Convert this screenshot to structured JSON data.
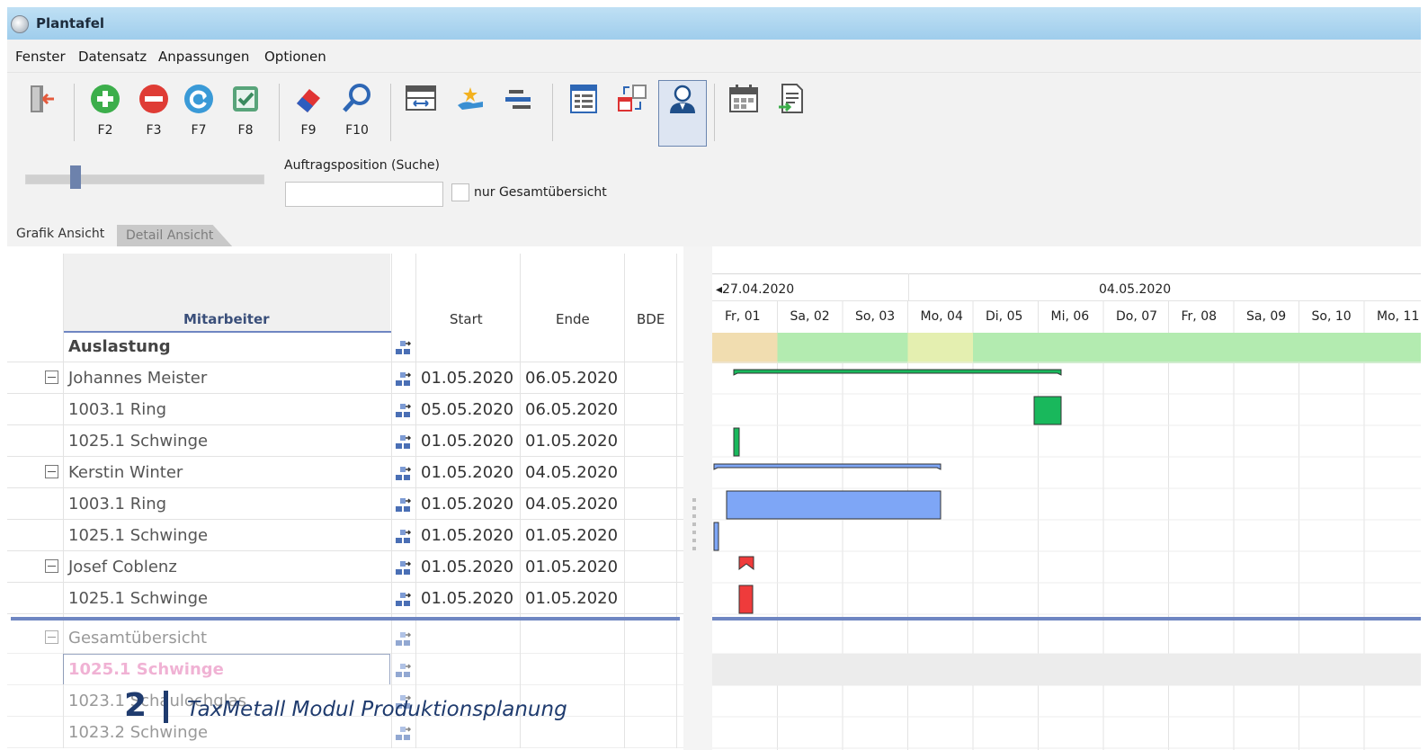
{
  "window": {
    "title": "Plantafel"
  },
  "menu": [
    "Fenster",
    "Datensatz",
    "Anpassungen",
    "Optionen"
  ],
  "toolbar": {
    "buttons": [
      {
        "icon": "exit-icon",
        "label": ""
      },
      {
        "icon": "add-icon",
        "label": "F2"
      },
      {
        "icon": "remove-icon",
        "label": "F3"
      },
      {
        "icon": "refresh-icon",
        "label": "F7"
      },
      {
        "icon": "save-icon",
        "label": "F8"
      },
      {
        "icon": "eraser-icon",
        "label": "F9"
      },
      {
        "icon": "search-icon",
        "label": "F10"
      },
      {
        "icon": "grid-columns-icon",
        "label": ""
      },
      {
        "icon": "hand-star-icon",
        "label": ""
      },
      {
        "icon": "align-icon",
        "label": ""
      },
      {
        "icon": "form-icon",
        "label": ""
      },
      {
        "icon": "calendar-transfer-icon",
        "label": ""
      },
      {
        "icon": "user-icon",
        "label": ""
      },
      {
        "icon": "calendar-icon",
        "label": ""
      },
      {
        "icon": "document-export-icon",
        "label": ""
      }
    ]
  },
  "search": {
    "label": "Auftragsposition (Suche)",
    "value": "",
    "checkbox_label": "nur Gesamtübersicht",
    "checkbox_checked": false,
    "slider_fraction": 0.2
  },
  "tabs": [
    {
      "label": "Grafik Ansicht",
      "active": true
    },
    {
      "label": "Detail Ansicht",
      "active": false
    }
  ],
  "grid": {
    "columns": {
      "mitarbeiter": "Mitarbeiter",
      "start": "Start",
      "ende": "Ende",
      "bde": "BDE"
    },
    "rows": [
      {
        "name": "Auslastung",
        "start": "",
        "ende": "",
        "expand": false,
        "bold": true
      },
      {
        "name": "Johannes Meister",
        "start": "01.05.2020",
        "ende": "06.05.2020",
        "expand": true
      },
      {
        "name": "1003.1 Ring",
        "start": "05.05.2020",
        "ende": "06.05.2020",
        "expand": false
      },
      {
        "name": "1025.1 Schwinge",
        "start": "01.05.2020",
        "ende": "01.05.2020",
        "expand": false
      },
      {
        "name": "Kerstin Winter",
        "start": "01.05.2020",
        "ende": "04.05.2020",
        "expand": true
      },
      {
        "name": "1003.1 Ring",
        "start": "01.05.2020",
        "ende": "04.05.2020",
        "expand": false
      },
      {
        "name": "1025.1 Schwinge",
        "start": "01.05.2020",
        "ende": "01.05.2020",
        "expand": false
      },
      {
        "name": "Josef Coblenz",
        "start": "01.05.2020",
        "ende": "01.05.2020",
        "expand": true
      },
      {
        "name": "1025.1 Schwinge",
        "start": "01.05.2020",
        "ende": "01.05.2020",
        "expand": false
      }
    ],
    "overview_rows": [
      {
        "name": "Gesamtübersicht",
        "expand": true
      },
      {
        "name": "1025.1 Schwinge",
        "selected": true
      },
      {
        "name": "1023.1 Schaulochglas"
      },
      {
        "name": "1023.2 Schwinge"
      }
    ]
  },
  "gantt": {
    "weeks": [
      "27.04.2020",
      "04.05.2020"
    ],
    "days": [
      "Fr, 01",
      "Sa, 02",
      "So, 03",
      "Mo, 04",
      "Di, 05",
      "Mi, 06",
      "Do, 07",
      "Fr, 08",
      "Sa, 09",
      "So, 10",
      "Mo, 11"
    ],
    "load_colors": [
      "#f1ddb0",
      "#b3ebb0",
      "#b3ebb0",
      "#e4efb0",
      "#b3ebb0",
      "#b3ebb0",
      "#b3ebb0",
      "#b3ebb0",
      "#b3ebb0",
      "#b3ebb0",
      "#b3ebb0"
    ],
    "colors": {
      "green": "#19b85c",
      "blue": "#7ea6f6",
      "red": "#ef3b3b",
      "separator": "#6f86c2"
    }
  },
  "footer": {
    "page_number": "2",
    "text": "TaxMetall Modul Produktionsplanung"
  }
}
